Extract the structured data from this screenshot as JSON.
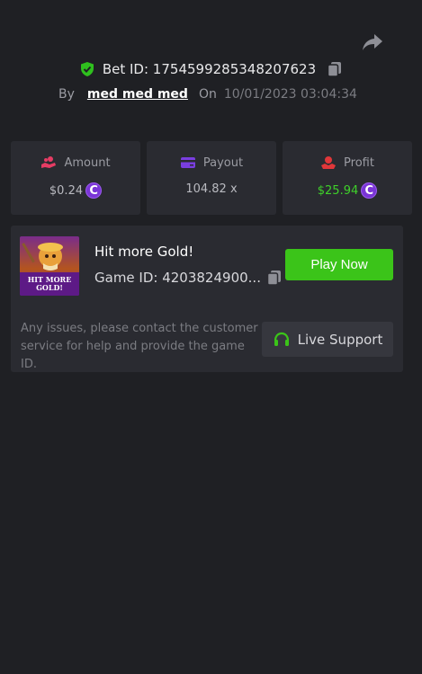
{
  "header": {
    "bet_label": "Bet ID: 1754599285348207623",
    "by_label": "By",
    "username": "med med med",
    "on_label": "On",
    "date": "10/01/2023 03:04:34"
  },
  "stats": {
    "amount": {
      "label": "Amount",
      "value": "$0.24",
      "icon": "hand-coins-icon"
    },
    "payout": {
      "label": "Payout",
      "value": "104.82 x",
      "icon": "card-icon"
    },
    "profit": {
      "label": "Profit",
      "value": "$25.94",
      "icon": "hand-money-icon"
    }
  },
  "game": {
    "thumb_text_line1": "HIT MORE",
    "thumb_text_line2": "GOLD!",
    "title": "Hit more Gold!",
    "id_label": "Game ID: 4203824900...",
    "play_label": "Play Now"
  },
  "support": {
    "text": "Any issues, please contact the customer service for help and provide the game ID.",
    "button_label": "Live Support"
  },
  "colors": {
    "background": "#1f2024",
    "card": "#2a2b31",
    "accent_green": "#3bc419",
    "profit_green": "#3fd12a",
    "coin_purple": "#7a35d6"
  }
}
